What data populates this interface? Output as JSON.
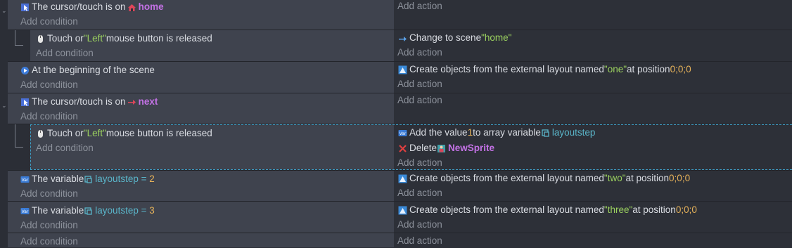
{
  "add_condition": "Add condition",
  "add_action": "Add action",
  "events": [
    {
      "conditions": [
        {
          "icon": "cursor-icon",
          "parts": [
            "The cursor/touch is on "
          ],
          "object_icon": "home-icon",
          "object": "home"
        }
      ],
      "actions": []
    },
    {
      "conditions": [
        {
          "icon": "mouse-icon",
          "t1": "Touch or ",
          "s1": "\"Left\"",
          "t2": " mouse button is released"
        }
      ],
      "actions": [
        {
          "icon": "arrow-icon",
          "t1": "Change to scene ",
          "s1": "\"home\""
        }
      ]
    },
    {
      "conditions": [
        {
          "icon": "scene-start-icon",
          "text": "At the beginning of the scene"
        }
      ],
      "actions": [
        {
          "icon": "external-layout-icon",
          "t1": "Create objects from the external layout named ",
          "s1": "\"one\"",
          "t2": " at position ",
          "n1": "0;0;0"
        }
      ]
    },
    {
      "conditions": [
        {
          "icon": "cursor-icon",
          "text": "The cursor/touch is on ",
          "object_icon": "arrow-right-icon",
          "object": "next"
        }
      ],
      "actions": []
    },
    {
      "conditions": [
        {
          "icon": "mouse-icon",
          "t1": "Touch or ",
          "s1": "\"Left\"",
          "t2": " mouse button is released"
        }
      ],
      "actions": [
        {
          "icon": "variable-icon",
          "t1": "Add the value ",
          "n1": "1",
          "t2": " to array variable ",
          "var_icon": "variable-small-icon",
          "var": "layoutstep"
        },
        {
          "icon": "delete-icon",
          "t1": "Delete ",
          "object_icon": "sprite-icon",
          "object": "NewSprite"
        }
      ]
    },
    {
      "conditions": [
        {
          "icon": "variable-icon",
          "t1": "The variable ",
          "var_icon": "variable-small-icon",
          "var": "layoutstep",
          "op": " = ",
          "n1": "2"
        }
      ],
      "actions": [
        {
          "icon": "external-layout-icon",
          "t1": "Create objects from the external layout named ",
          "s1": "\"two\"",
          "t2": " at position ",
          "n1": "0;0;0"
        }
      ]
    },
    {
      "conditions": [
        {
          "icon": "variable-icon",
          "t1": "The variable ",
          "var_icon": "variable-small-icon",
          "var": "layoutstep",
          "op": " = ",
          "n1": "3"
        }
      ],
      "actions": [
        {
          "icon": "external-layout-icon",
          "t1": "Create objects from the external layout named ",
          "s1": "\"three\"",
          "t2": " at position ",
          "n1": "0;0;0"
        }
      ]
    }
  ],
  "colors": {
    "string": "#9bd15f",
    "number": "#e6b25a",
    "object": "#c472e6",
    "variable": "#5ab5c9"
  }
}
